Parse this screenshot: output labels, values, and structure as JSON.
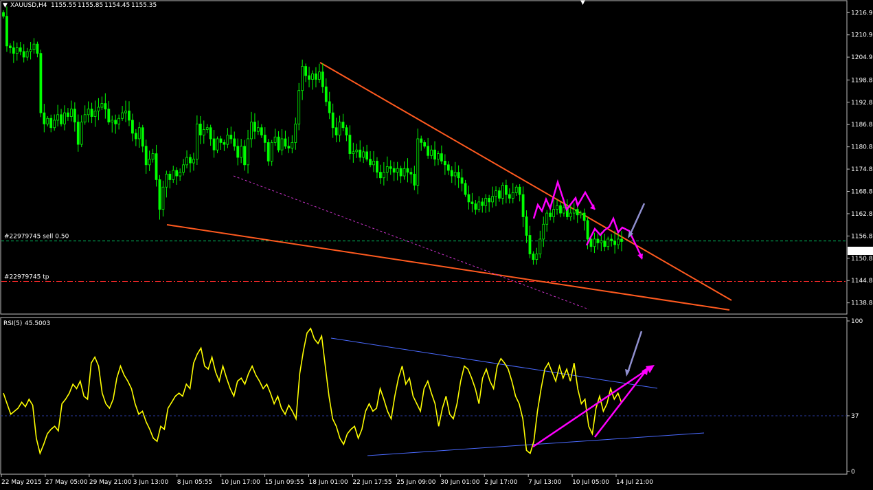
{
  "chart_data": {
    "type": "candlestick+line",
    "symbol_header": "XAUUSD,H4",
    "ohlc_header": {
      "open": "1155.55",
      "high": "1155.85",
      "low": "1154.45",
      "close": "1155.35"
    },
    "price_axis": {
      "ylim": [
        1136.0,
        1220.0
      ],
      "ticks": [
        "1216.99",
        "1210.99",
        "1204.99",
        "1198.84",
        "1192.84",
        "1186.84",
        "1180.84",
        "1174.84",
        "1168.84",
        "1162.84",
        "1156.84",
        "1150.84",
        "1144.84",
        "1138.84"
      ],
      "current_price": "1155.35"
    },
    "rsi": {
      "label": "RSI(5)",
      "value": "45.5003",
      "ylim": [
        0,
        100
      ],
      "ticks": [
        "100",
        "37",
        "0"
      ],
      "level": 37
    },
    "time_axis": {
      "labels": [
        "22 May 2015",
        "27 May 05:00",
        "29 May 21:00",
        "3 Jun 13:00",
        "8 Jun 05:55",
        "10 Jun 17:00",
        "15 Jun 09:55",
        "18 Jun 01:00",
        "22 Jun 17:55",
        "25 Jun 09:00",
        "30 Jun 01:00",
        "2 Jul 17:00",
        "7 Jul 13:00",
        "10 Jul 05:00",
        "14 Jul 21:00"
      ]
    },
    "order_lines": [
      {
        "label": "#22979745 sell 0.50",
        "price": 1155.5,
        "style": "dashed",
        "color": "#00c060"
      },
      {
        "label": "#22979745 tp",
        "price": 1144.6,
        "style": "dashdot",
        "color": "#ff2a2a"
      }
    ],
    "colors": {
      "background": "#000000",
      "candle": "#00ff00",
      "rsi_line": "#ffff00",
      "trendline": "#ff5a1f",
      "rsi_trendline": "#4a6aff",
      "annotation": "#ff00ff",
      "arrow": "#8888cc",
      "text": "#ffffff"
    },
    "price_series": [
      1216.0,
      1208.0,
      1207.5,
      1206.0,
      1207.5,
      1206.5,
      1205.0,
      1206.5,
      1207.0,
      1208.5,
      1206.0,
      1190.0,
      1187.0,
      1188.5,
      1186.0,
      1188.0,
      1189.5,
      1187.0,
      1190.0,
      1189.0,
      1191.0,
      1187.5,
      1181.5,
      1187.5,
      1189.5,
      1191.0,
      1189.0,
      1190.5,
      1191.5,
      1192.5,
      1191.0,
      1187.5,
      1188.0,
      1187.0,
      1188.5,
      1190.0,
      1190.5,
      1188.0,
      1184.5,
      1183.0,
      1186.0,
      1181.0,
      1176.0,
      1177.5,
      1179.0,
      1172.0,
      1164.0,
      1170.0,
      1173.5,
      1172.0,
      1174.5,
      1173.0,
      1174.0,
      1176.0,
      1178.0,
      1176.5,
      1177.5,
      1187.0,
      1184.0,
      1185.5,
      1186.0,
      1183.0,
      1180.0,
      1183.0,
      1182.0,
      1181.5,
      1184.0,
      1183.0,
      1181.0,
      1178.0,
      1181.0,
      1176.0,
      1183.0,
      1187.5,
      1185.0,
      1186.0,
      1184.0,
      1182.0,
      1177.0,
      1182.0,
      1183.5,
      1180.0,
      1183.0,
      1181.0,
      1180.5,
      1182.0,
      1187.0,
      1196.0,
      1202.5,
      1200.0,
      1199.0,
      1200.5,
      1199.0,
      1201.0,
      1197.0,
      1193.0,
      1190.0,
      1186.0,
      1184.0,
      1187.5,
      1186.0,
      1184.0,
      1179.0,
      1179.5,
      1180.0,
      1178.0,
      1179.5,
      1177.5,
      1176.0,
      1177.0,
      1174.0,
      1172.5,
      1174.0,
      1175.5,
      1175.0,
      1174.0,
      1175.0,
      1173.0,
      1175.0,
      1174.0,
      1173.5,
      1170.5,
      1183.0,
      1182.0,
      1181.0,
      1178.5,
      1180.0,
      1177.5,
      1179.0,
      1177.0,
      1176.0,
      1174.5,
      1173.0,
      1174.0,
      1172.5,
      1171.0,
      1168.0,
      1166.0,
      1165.5,
      1164.0,
      1166.0,
      1165.0,
      1167.0,
      1166.0,
      1167.5,
      1169.0,
      1167.0,
      1170.5,
      1168.0,
      1167.0,
      1168.5,
      1170.0,
      1168.0,
      1162.0,
      1157.0,
      1152.0,
      1150.5,
      1152.0,
      1156.0,
      1160.0,
      1163.0,
      1162.0,
      1164.0,
      1165.0,
      1163.0,
      1164.5,
      1162.0,
      1163.0,
      1164.0,
      1162.5,
      1163.0,
      1161.0,
      1156.0,
      1154.0,
      1156.0,
      1155.0,
      1155.5,
      1154.0,
      1156.0,
      1155.5,
      1154.5,
      1156.0,
      1155.35
    ],
    "rsi_series": [
      52,
      45,
      38,
      40,
      42,
      46,
      43,
      48,
      44,
      22,
      12,
      18,
      25,
      28,
      30,
      27,
      45,
      48,
      52,
      58,
      55,
      60,
      50,
      48,
      72,
      76,
      70,
      52,
      45,
      42,
      48,
      62,
      70,
      64,
      60,
      55,
      45,
      38,
      40,
      33,
      28,
      22,
      20,
      30,
      28,
      42,
      46,
      50,
      52,
      50,
      58,
      55,
      72,
      78,
      82,
      70,
      68,
      76,
      66,
      60,
      70,
      62,
      55,
      50,
      60,
      62,
      58,
      65,
      70,
      64,
      60,
      55,
      58,
      52,
      45,
      50,
      42,
      38,
      44,
      40,
      35,
      65,
      80,
      92,
      95,
      88,
      85,
      90,
      70,
      50,
      35,
      30,
      22,
      18,
      25,
      28,
      30,
      22,
      28,
      40,
      45,
      40,
      42,
      55,
      48,
      40,
      35,
      50,
      62,
      70,
      58,
      62,
      50,
      45,
      40,
      55,
      60,
      52,
      45,
      30,
      42,
      50,
      38,
      35,
      45,
      60,
      70,
      68,
      62,
      55,
      45,
      62,
      68,
      60,
      55,
      70,
      75,
      72,
      68,
      60,
      50,
      45,
      35,
      14,
      12,
      20,
      40,
      55,
      68,
      72,
      66,
      60,
      70,
      62,
      68,
      60,
      72,
      55,
      45,
      48,
      30,
      25,
      42,
      50,
      40,
      45,
      55,
      48,
      52,
      45.5
    ]
  }
}
